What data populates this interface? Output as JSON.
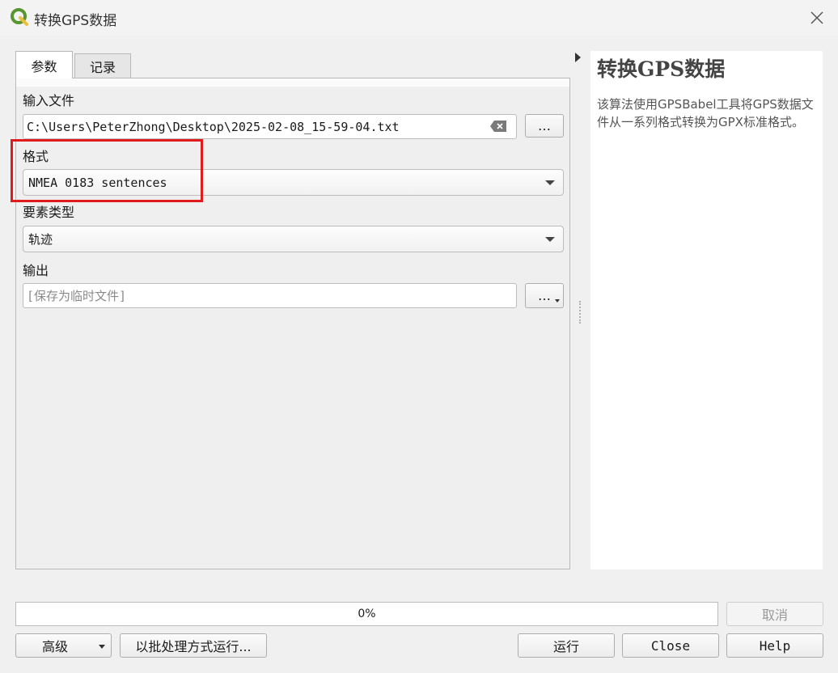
{
  "window": {
    "title": "转换GPS数据",
    "app_icon": "qgis-logo-icon",
    "close_icon": "close-icon"
  },
  "tabs": [
    {
      "label": "参数",
      "active": true
    },
    {
      "label": "记录",
      "active": false
    }
  ],
  "params": {
    "input_file": {
      "label": "输入文件",
      "value": "C:\\Users\\PeterZhong\\Desktop\\2025-02-08_15-59-04.txt",
      "clear_icon": "clear-backspace-icon",
      "browse_label": "…"
    },
    "format": {
      "label": "格式",
      "value": "NMEA 0183 sentences"
    },
    "feature_type": {
      "label": "要素类型",
      "value": "轨迹"
    },
    "output": {
      "label": "输出",
      "placeholder": "[保存为临时文件]",
      "browse_label": "…"
    }
  },
  "help": {
    "title": "转换GPS数据",
    "description": "该算法使用GPSBabel工具将GPS数据文件从一系列格式转换为GPX标准格式。"
  },
  "footer": {
    "progress": "0%",
    "progress_value": 0,
    "cancel_label": "取消",
    "advanced_label": "高级",
    "batch_label": "以批处理方式运行...",
    "run_label": "运行",
    "close_label": "Close",
    "help_label": "Help"
  },
  "colors": {
    "highlight": "#e01b1b",
    "qgis_green": "#589632",
    "qgis_yellow": "#eebe36"
  }
}
